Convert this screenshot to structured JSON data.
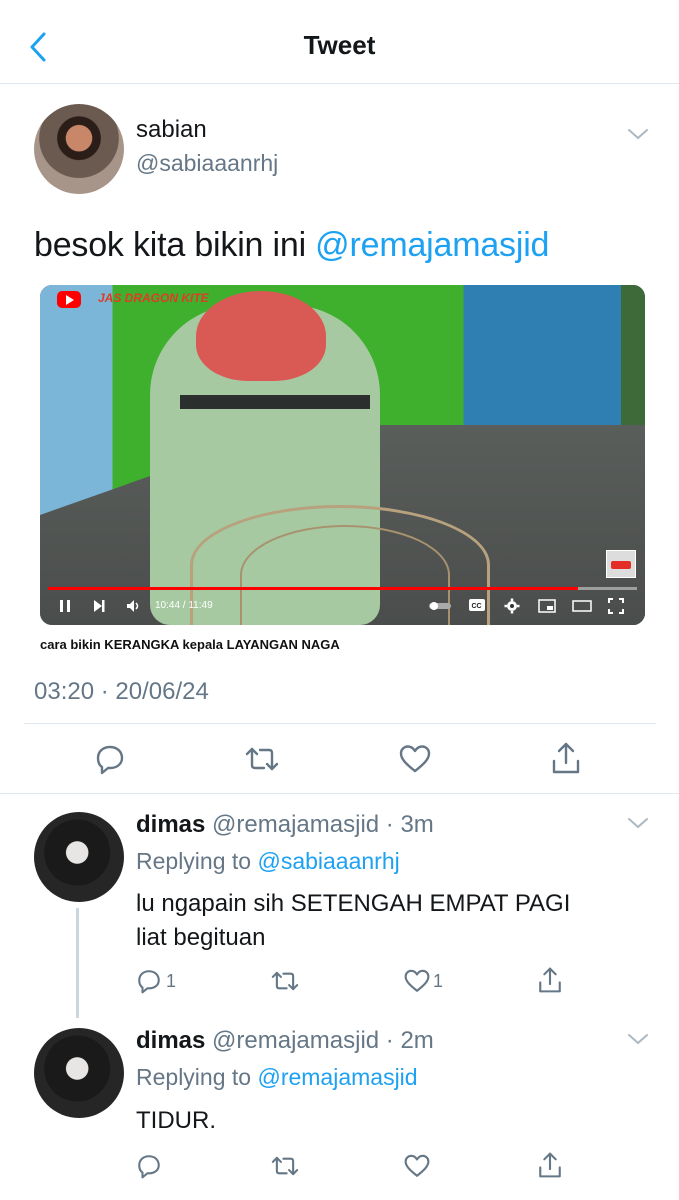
{
  "header": {
    "title": "Tweet",
    "back_icon": "chevron-left-icon"
  },
  "main_tweet": {
    "name": "sabian",
    "handle": "@sabiaaanrhj",
    "text_prefix": "besok kita bikin ini ",
    "text_mention": "@remajamasjid",
    "video": {
      "channel_label": "JAS DRAGON KITE",
      "time": "10:44 / 11:49",
      "progress": 0.9,
      "caption": "cara bikin KERANGKA kepala LAYANGAN NAGA"
    },
    "timestamp": "03:20 · 20/06/24"
  },
  "replies": [
    {
      "name": "dimas",
      "handle_time": "@remajamasjid · 3m",
      "replying_label": "Replying to ",
      "replying_to": "@sabiaaanrhj",
      "text_line1": "lu ngapain sih SETENGAH EMPAT PAGI",
      "text_line2": "liat begituan",
      "reply_count": "1",
      "like_count": "1"
    },
    {
      "name": "dimas",
      "handle_time": "@remajamasjid · 2m",
      "replying_label": "Replying to ",
      "replying_to": "@remajamasjid",
      "text_line1": "TIDUR."
    }
  ],
  "colors": {
    "accent": "#1da1f2",
    "secondary_text": "#657786",
    "divider": "#e1e8ed",
    "progress": "#ff0000"
  }
}
